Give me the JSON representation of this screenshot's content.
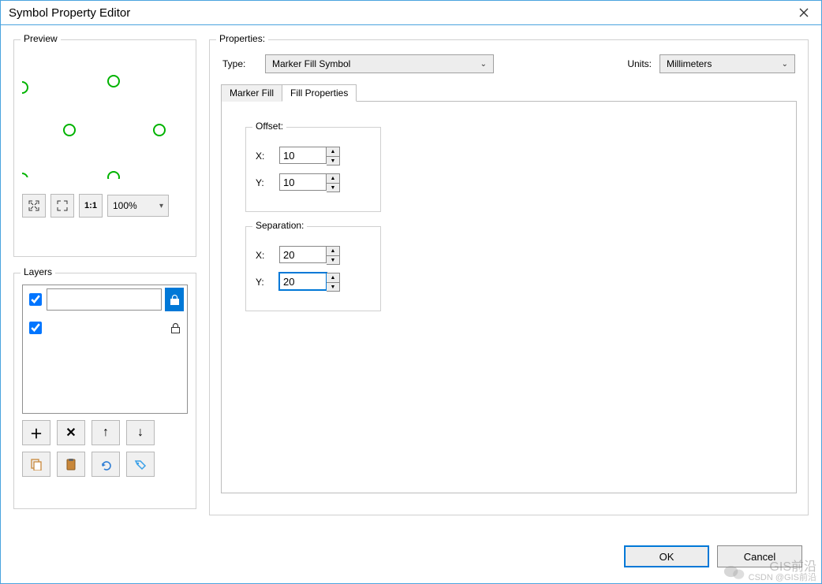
{
  "window": {
    "title": "Symbol Property Editor"
  },
  "preview": {
    "label": "Preview",
    "zoom": "100%"
  },
  "layers": {
    "label": "Layers"
  },
  "properties": {
    "label": "Properties:",
    "type_label": "Type:",
    "type_value": "Marker Fill Symbol",
    "units_label": "Units:",
    "units_value": "Millimeters",
    "tabs": {
      "marker_fill": "Marker Fill",
      "fill_properties": "Fill Properties"
    },
    "offset": {
      "label": "Offset:",
      "x_label": "X:",
      "x_value": "10",
      "y_label": "Y:",
      "y_value": "10"
    },
    "separation": {
      "label": "Separation:",
      "x_label": "X:",
      "x_value": "20",
      "y_label": "Y:",
      "y_value": "20"
    }
  },
  "buttons": {
    "ok": "OK",
    "cancel": "Cancel"
  },
  "watermark": {
    "brand": "GIS前沿",
    "credit": "CSDN @GIS前沿"
  }
}
